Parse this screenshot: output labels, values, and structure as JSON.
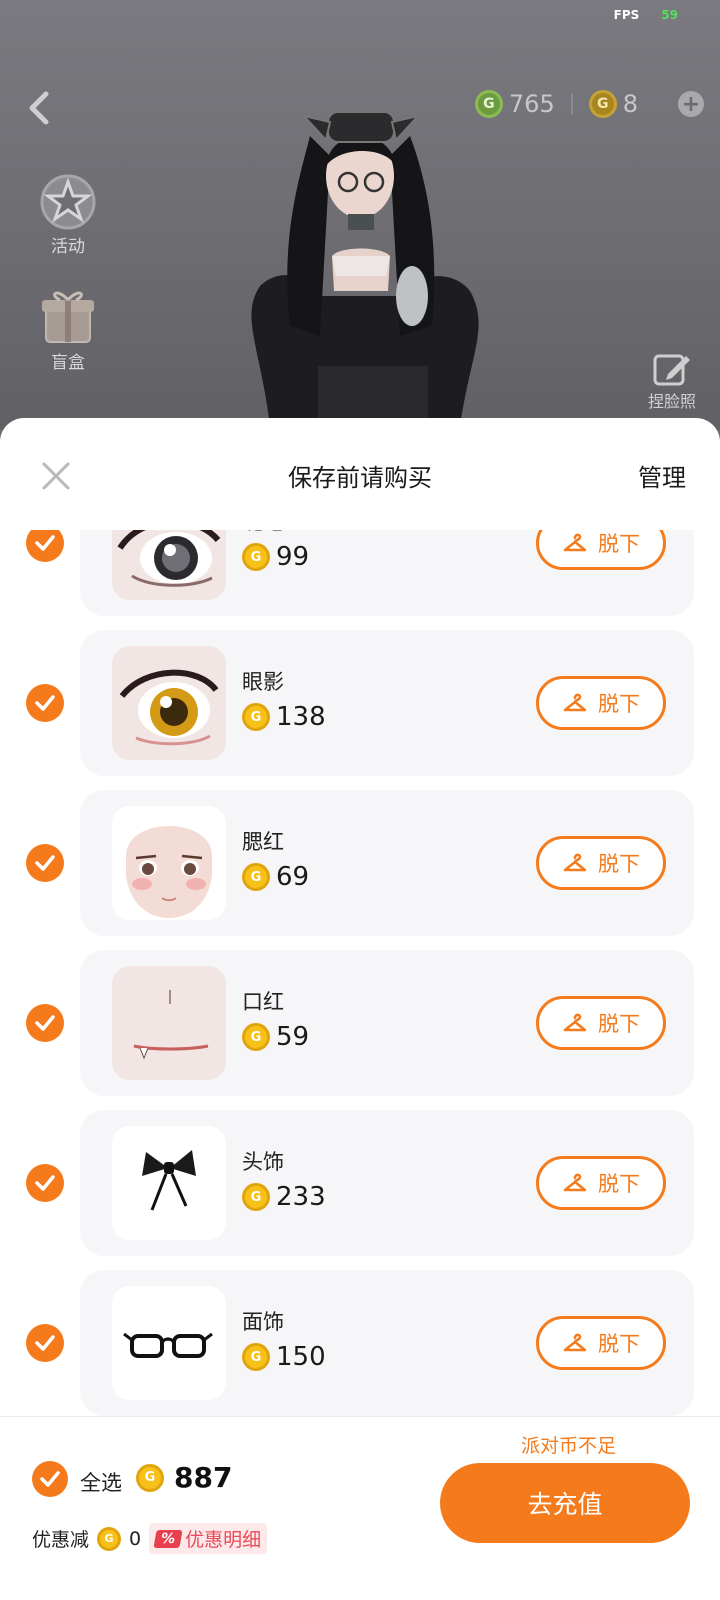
{
  "status": {
    "fps_label": "FPS",
    "fps_value": "59"
  },
  "wallet": {
    "green_coins": "765",
    "gold_coins": "8"
  },
  "side_menu": [
    {
      "label": "活动"
    },
    {
      "label": "盲盒"
    }
  ],
  "face_button_label": "捏脸照",
  "sheet": {
    "title": "保存前请购买",
    "manage_label": "管理"
  },
  "items": [
    {
      "name": "睫毛",
      "price": "99",
      "action": "脱下"
    },
    {
      "name": "眼影",
      "price": "138",
      "action": "脱下"
    },
    {
      "name": "腮红",
      "price": "69",
      "action": "脱下"
    },
    {
      "name": "口红",
      "price": "59",
      "action": "脱下"
    },
    {
      "name": "头饰",
      "price": "233",
      "action": "脱下"
    },
    {
      "name": "面饰",
      "price": "150",
      "action": "脱下"
    }
  ],
  "footer": {
    "insufficient": "派对币不足",
    "select_all": "全选",
    "total": "887",
    "discount_label": "优惠减",
    "discount_value": "0",
    "discount_detail": "优惠明细",
    "discount_badge": "%",
    "recharge": "去充值"
  },
  "colors": {
    "accent": "#f47a1b",
    "coin": "#f6c21a",
    "card_bg": "#f6f6f8"
  },
  "icons": {
    "coin_letter": "G"
  }
}
